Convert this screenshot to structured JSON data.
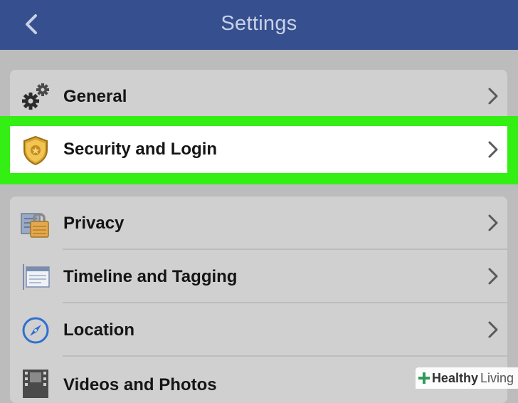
{
  "navbar": {
    "title": "Settings",
    "back_icon": "chevron-left-icon",
    "background": "#364f8f"
  },
  "groups": [
    {
      "items": [
        {
          "label": "General",
          "icon": "gears-icon"
        }
      ]
    },
    {
      "items": [
        {
          "label": "Privacy",
          "icon": "padlock-icon"
        },
        {
          "label": "Timeline and Tagging",
          "icon": "timeline-icon"
        },
        {
          "label": "Location",
          "icon": "compass-icon"
        },
        {
          "label": "Videos and Photos",
          "icon": "film-icon"
        }
      ]
    }
  ],
  "highlighted_item": {
    "label": "Security and Login",
    "icon": "shield-badge-icon"
  },
  "highlight_color": "#33ef14",
  "watermark": {
    "brand": "Healthy",
    "sub": "Living"
  }
}
